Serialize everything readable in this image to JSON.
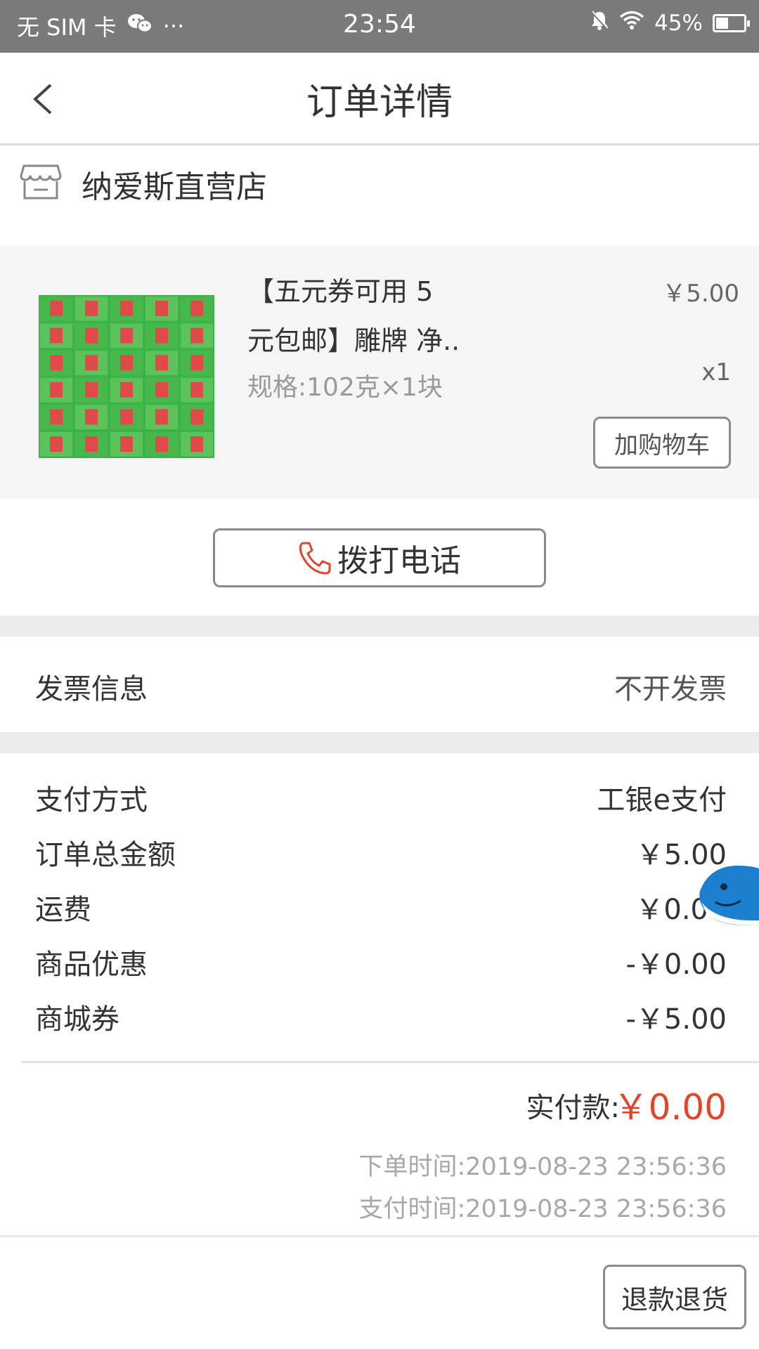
{
  "status_bar": {
    "carrier": "无 SIM 卡",
    "more": "···",
    "time": "23:54",
    "battery_percent": "45%",
    "battery_level": 0.45
  },
  "nav": {
    "title": "订单详情"
  },
  "store": {
    "name": "纳爱斯直营店"
  },
  "product": {
    "title_line1": "【五元券可用 5",
    "title_line2": "元包邮】雕牌 净..",
    "spec": "规格:102克×1块",
    "price": "￥5.00",
    "quantity": "x1",
    "add_cart_label": "加购物车"
  },
  "call": {
    "label": "拨打电话"
  },
  "invoice": {
    "label": "发票信息",
    "value": "不开发票"
  },
  "payment": {
    "rows": [
      {
        "label": "支付方式",
        "value": "工银e支付"
      },
      {
        "label": "订单总金额",
        "value": "￥5.00"
      },
      {
        "label": "运费",
        "value": "￥0.0"
      },
      {
        "label": "商品优惠",
        "value": "-￥0.00"
      },
      {
        "label": "商城券",
        "value": "-￥5.00"
      }
    ]
  },
  "summary": {
    "paid_label": "实付款:",
    "paid_value": "￥0.00",
    "order_time": "下单时间:2019-08-23 23:56:36",
    "pay_time": "支付时间:2019-08-23 23:56:36"
  },
  "actions": {
    "refund_label": "退款退货"
  },
  "colors": {
    "accent_price": "#e0462b",
    "status_bar": "#7a7a7a",
    "product_bg": "#f5f5f5"
  }
}
